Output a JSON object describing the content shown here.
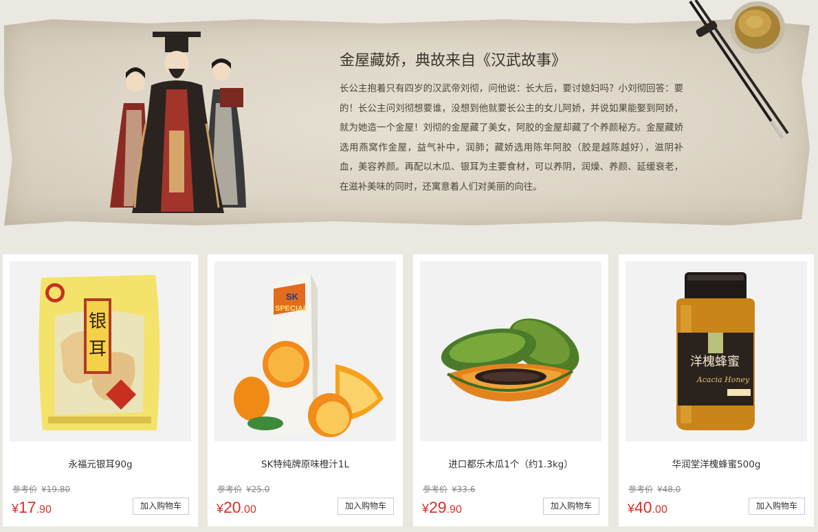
{
  "story": {
    "title": "金屋藏娇，典故来自《汉武故事》",
    "body": "长公主抱着只有四岁的汉武帝刘彻，问他说：长大后，要讨媳妇吗？小刘彻回答：要的！长公主问刘彻想要谁，没想到他就要长公主的女儿阿娇，并说如果能娶到阿娇，就为她造一个金屋！刘彻的金屋藏了美女，阿胶的金屋却藏了个养颜秘方。金屋藏娇选用燕窝作金屋，益气补中，润肺；藏娇选用陈年阿胶（胶是越陈越好），滋阴补血，美容养颜。再配以木瓜、银耳为主要食材，可以养阴，润燥、养颜、延缓衰老，在滋补美味的同时，还寓意着人们对美丽的向往。"
  },
  "products": [
    {
      "name": "永福元银耳90g",
      "ref_label": "参考价",
      "ref_price": "¥19.80",
      "currency": "¥",
      "price_int": "17",
      "price_dec": ".90",
      "cart_label": "加入购物车",
      "image": "tremella-package"
    },
    {
      "name": "SK特纯牌原味橙汁1L",
      "ref_label": "参考价",
      "ref_price": "¥25.0",
      "currency": "¥",
      "price_int": "20",
      "price_dec": ".00",
      "cart_label": "加入购物车",
      "image": "orange-juice-carton"
    },
    {
      "name": "进口都乐木瓜1个（约1.3kg）",
      "ref_label": "参考价",
      "ref_price": "¥33.6",
      "currency": "¥",
      "price_int": "29",
      "price_dec": ".90",
      "cart_label": "加入购物车",
      "image": "papaya"
    },
    {
      "name": "华润堂洋槐蜂蜜500g",
      "ref_label": "参考价",
      "ref_price": "¥48.0",
      "currency": "¥",
      "price_int": "40",
      "price_dec": ".00",
      "cart_label": "加入购物车",
      "image": "honey-jar"
    }
  ],
  "image_text": {
    "tremella_label": "银耳",
    "juice_brand": "SK",
    "juice_sub": "SPECIAL",
    "honey_label": "洋槐蜂蜜",
    "honey_en": "Acacia Honey"
  },
  "colors": {
    "price": "#d9302c",
    "banner": "#ddd6c7",
    "page": "#ebe8e2"
  }
}
